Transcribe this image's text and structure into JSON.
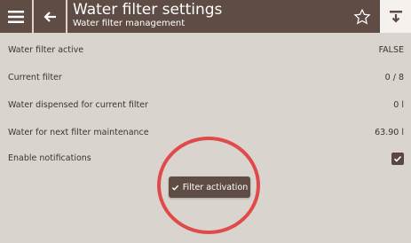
{
  "header": {
    "title": "Water filter settings",
    "subtitle": "Water filter management",
    "menu_icon": "hamburger-menu-icon",
    "back_icon": "arrow-left-icon",
    "favorite_icon": "star-outline-icon",
    "export_icon": "download-icon"
  },
  "settings": {
    "filter_active": {
      "label": "Water filter active",
      "value": "FALSE"
    },
    "current_filter": {
      "label": "Current filter",
      "value": "0 / 8"
    },
    "water_dispensed": {
      "label": "Water dispensed for current filter",
      "value": "0 l"
    },
    "next_maintenance": {
      "label": "Water for next filter maintenance",
      "value": "63.90 l"
    },
    "notifications": {
      "label": "Enable notifications",
      "checked": true
    }
  },
  "toast": {
    "text": "Filter activation",
    "icon": "checkmark-icon"
  },
  "colors": {
    "header_bg": "#5f4c44",
    "page_bg": "#dad4cf",
    "highlight": "#e04a4a"
  }
}
